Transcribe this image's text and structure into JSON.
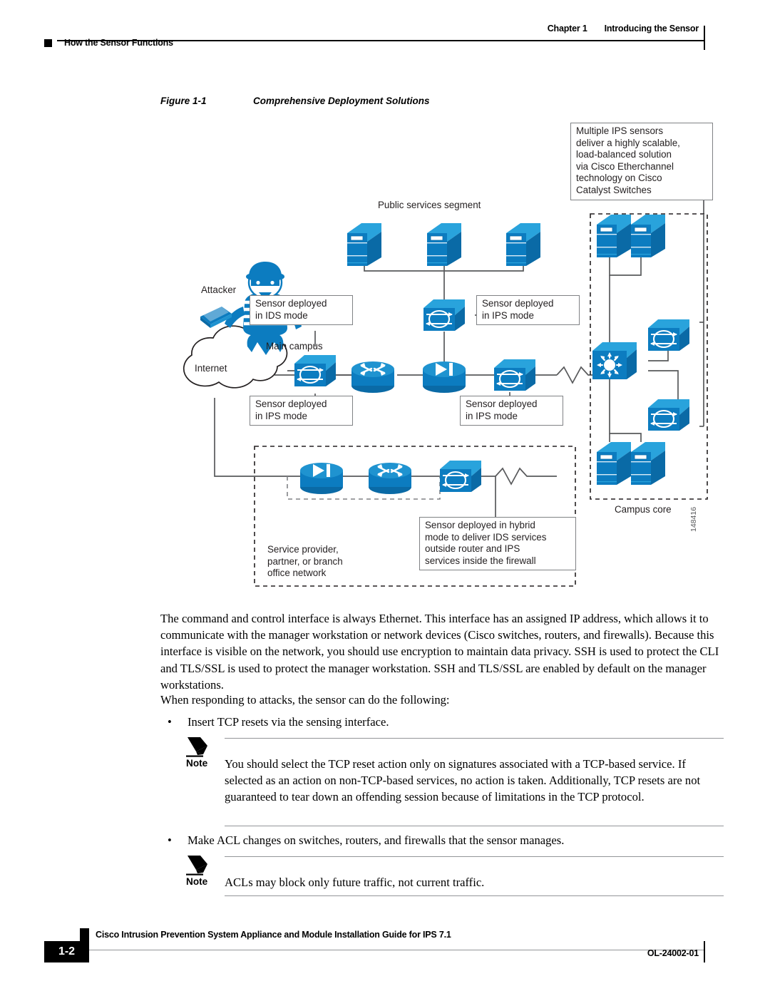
{
  "header": {
    "chapter_num": "Chapter 1",
    "chapter_title": "Introducing the Sensor",
    "section": "How the Sensor Functions"
  },
  "figure": {
    "number": "Figure 1-1",
    "title": "Comprehensive Deployment Solutions",
    "art_id": "148416",
    "callouts": {
      "etherchannel": "Multiple IPS sensors\ndeliver a highly scalable,\nload-balanced solution\nvia Cisco Etherchannel\ntechnology on Cisco\nCatalyst Switches",
      "ids_mode": "Sensor deployed\nin IDS mode",
      "ips_mode_public": "Sensor deployed\nin IPS mode",
      "ips_mode_internet": "Sensor deployed\nin IPS mode",
      "ips_mode_core": "Sensor deployed\nin IPS mode",
      "hybrid_mode": "Sensor deployed in hybrid\nmode to deliver IDS services\noutside router and IPS\nservices inside the firewall"
    },
    "labels": {
      "public_services": "Public services segment",
      "attacker": "Attacker",
      "internet": "Internet",
      "main_campus": "Main campus",
      "campus_core": "Campus core",
      "service_provider": "Service provider,\npartner, or branch\noffice network"
    },
    "colors": {
      "cisco_blue": "#0c7cc0",
      "cisco_blue_light": "#29a3dc",
      "cisco_blue_dark": "#0a6aa6",
      "line_gray": "#58595b"
    }
  },
  "body": {
    "paragraph_1": "The command and control interface is always Ethernet. This interface has an assigned IP address, which allows it to communicate with the manager workstation or network devices (Cisco switches, routers, and firewalls). Because this interface is visible on the network, you should use encryption to maintain data privacy. SSH is used to protect the CLI and TLS/SSL is used to protect the manager workstation. SSH and TLS/SSL are enabled by default on the manager workstations.",
    "paragraph_2": "When responding to attacks, the sensor can do the following:",
    "bullet_1": "Insert TCP resets via the sensing interface.",
    "bullet_2": "Make ACL changes on switches, routers, and firewalls that the sensor manages.",
    "bullet_marker": "•",
    "note_1_label": "Note",
    "note_1_text": "You should select the TCP reset action only on signatures associated with a TCP-based service. If selected as an action on non-TCP-based services, no action is taken. Additionally, TCP resets are not guaranteed to tear down an offending session because of limitations in the TCP protocol.",
    "note_2_label": "Note",
    "note_2_text": "ACLs may block only future traffic, not current traffic."
  },
  "footer": {
    "page_number": "1-2",
    "doc_title": "Cisco Intrusion Prevention System Appliance and Module Installation Guide for IPS 7.1",
    "doc_id": "OL-24002-01"
  }
}
